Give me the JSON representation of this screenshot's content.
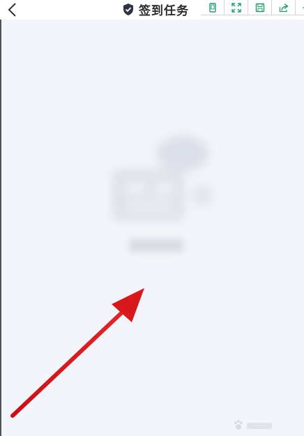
{
  "header": {
    "title": "签到任务",
    "back_icon": "chevron-left-icon",
    "title_icon": "shield-check-icon"
  },
  "toolbar": {
    "accent_color": "#1f9d68",
    "buttons": [
      {
        "name": "phone-screen-icon"
      },
      {
        "name": "fullscreen-icon"
      },
      {
        "name": "save-icon"
      },
      {
        "name": "share-icon"
      },
      {
        "name": "gear-icon"
      }
    ]
  },
  "colors": {
    "background": "#f3f5fa",
    "arrow": "#d4161a"
  }
}
